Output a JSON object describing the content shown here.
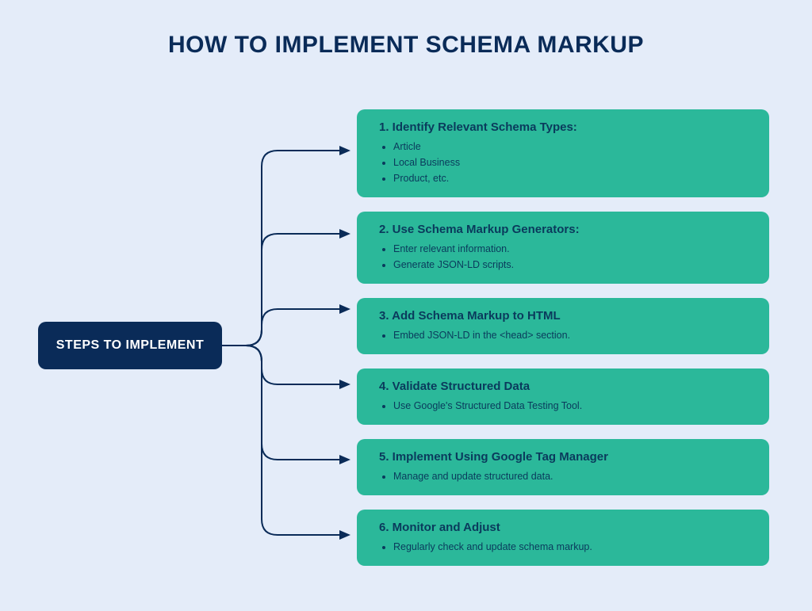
{
  "title": "HOW TO IMPLEMENT SCHEMA MARKUP",
  "root_label": "STEPS TO IMPLEMENT",
  "steps": [
    {
      "title": "1. Identify Relevant Schema Types:",
      "items": [
        "Article",
        "Local Business",
        "Product, etc."
      ]
    },
    {
      "title": "2. Use Schema Markup Generators:",
      "items": [
        "Enter relevant information.",
        "Generate JSON-LD scripts."
      ]
    },
    {
      "title": "3. Add Schema Markup to HTML",
      "items": [
        "Embed JSON-LD in the <head> section."
      ]
    },
    {
      "title": "4. Validate Structured Data",
      "items": [
        "Use Google's Structured Data Testing Tool."
      ]
    },
    {
      "title": "5. Implement Using Google Tag Manager",
      "items": [
        "Manage and update structured data."
      ]
    },
    {
      "title": "6. Monitor and Adjust",
      "items": [
        "Regularly check and update schema markup."
      ]
    }
  ],
  "colors": {
    "bg": "#e4ecf9",
    "root": "#0a2b58",
    "step": "#2bb89a",
    "text": "#0a3a5c"
  }
}
